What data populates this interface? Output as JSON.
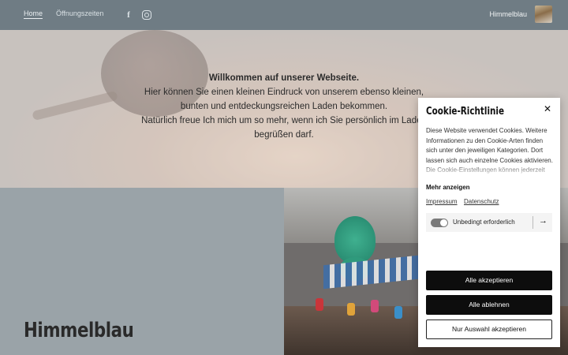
{
  "nav": {
    "home": "Home",
    "hours": "Öffnungszeiten",
    "brand": "Himmelblau"
  },
  "icons": {
    "facebook": "facebook-icon",
    "instagram": "instagram-icon"
  },
  "hero": {
    "headline": "Willkommen auf unserer Webseite.",
    "line1": "Hier können Sie einen kleinen Eindruck von unserem ebenso kleinen,",
    "line2": "bunten und entdeckungsreichen Laden bekommen.",
    "line3": "Natürlich freue Ich mich um so mehr, wenn ich Sie persönlich im Laden",
    "line4": "begrüßen darf."
  },
  "section": {
    "title": "Himmelblau"
  },
  "cookie": {
    "title": "Cookie-Richtlinie",
    "description": "Diese Website verwendet Cookies. Weitere Informationen zu den Cookie-Arten finden sich unter den jeweiligen Kategorien. Dort lassen sich auch einzelne Cookies aktivieren. Die Cookie-Einstellungen können jederzeit",
    "more": "Mehr anzeigen",
    "impressum": "Impressum",
    "privacy": "Datenschutz",
    "necessary_label": "Unbedingt erforderlich",
    "accept_all": "Alle akzeptieren",
    "reject_all": "Alle ablehnen",
    "accept_selection": "Nur Auswahl akzeptieren"
  },
  "colors": {
    "topbar": "#6f7c84",
    "button_dark": "#0d0d0d"
  }
}
